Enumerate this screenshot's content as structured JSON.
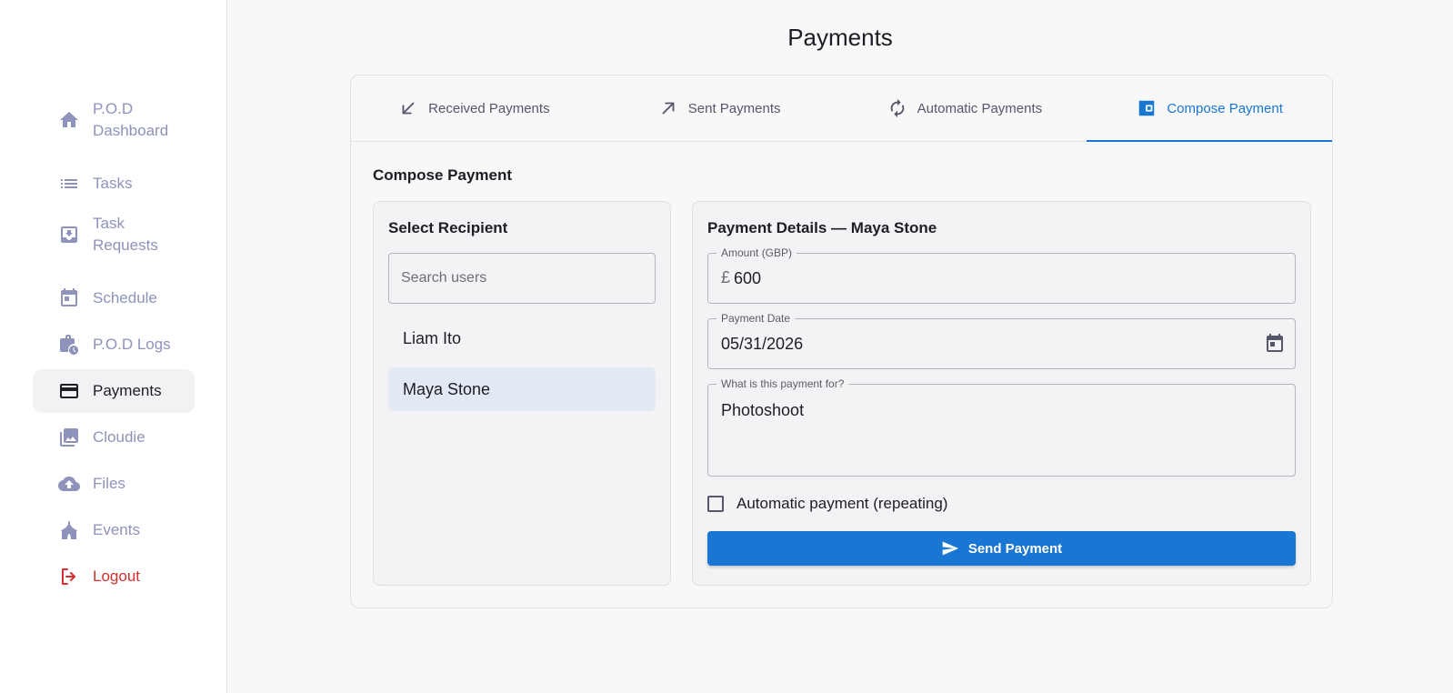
{
  "page_title": "Payments",
  "sidebar": {
    "items": [
      {
        "label": "P.O.D Dashboard",
        "icon": "home-icon"
      },
      {
        "label": "Tasks",
        "icon": "list-icon"
      },
      {
        "label": "Task Requests",
        "icon": "inbox-download-icon"
      },
      {
        "label": "Schedule",
        "icon": "calendar-icon"
      },
      {
        "label": "P.O.D Logs",
        "icon": "briefcase-clock-icon"
      },
      {
        "label": "Payments",
        "icon": "credit-card-icon",
        "active": true
      },
      {
        "label": "Cloudie",
        "icon": "photo-library-icon"
      },
      {
        "label": "Files",
        "icon": "cloud-upload-icon"
      },
      {
        "label": "Events",
        "icon": "circus-tent-icon"
      },
      {
        "label": "Logout",
        "icon": "logout-icon"
      }
    ]
  },
  "tabs": [
    {
      "label": "Received Payments",
      "icon": "arrow-down-left-icon"
    },
    {
      "label": "Sent Payments",
      "icon": "arrow-up-right-icon"
    },
    {
      "label": "Automatic Payments",
      "icon": "autorenew-icon"
    },
    {
      "label": "Compose Payment",
      "icon": "wallet-icon",
      "active": true
    }
  ],
  "compose": {
    "title": "Compose Payment",
    "recipient": {
      "title": "Select Recipient",
      "search_placeholder": "Search users",
      "users": [
        {
          "name": "Liam Ito"
        },
        {
          "name": "Maya Stone",
          "selected": true
        }
      ]
    },
    "details": {
      "title": "Payment Details — Maya Stone",
      "amount_label": "Amount (GBP)",
      "currency_symbol": "£",
      "amount": "600",
      "date_label": "Payment Date",
      "date": "05/31/2026",
      "purpose_label": "What is this payment for?",
      "purpose": "Photoshoot",
      "automatic_label": "Automatic payment (repeating)",
      "automatic_checked": false,
      "send_label": "Send Payment"
    }
  },
  "colors": {
    "accent": "#1976d2",
    "sidebar_text": "#8d93ba",
    "logout": "#d32f2f",
    "selected_row": "#e3e9f3"
  }
}
